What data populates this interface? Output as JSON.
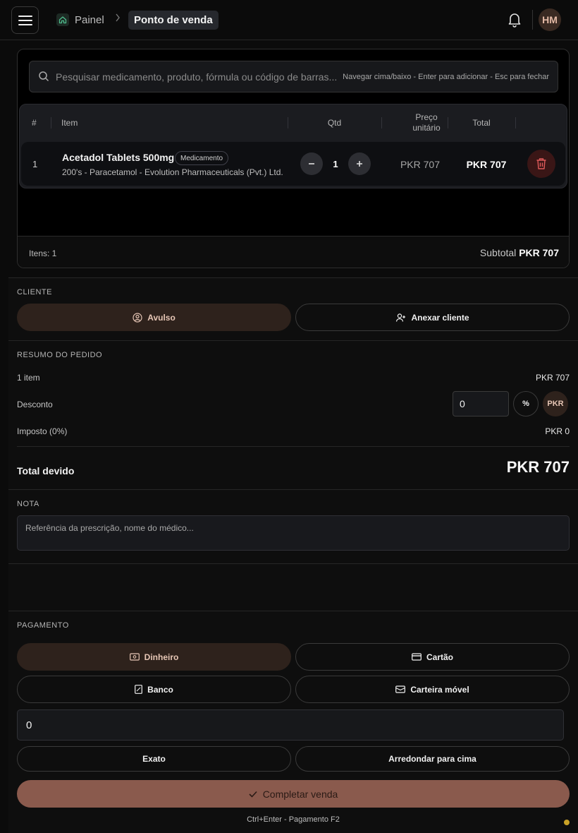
{
  "header": {
    "breadcrumb_home": "Painel",
    "breadcrumb_current": "Ponto de venda",
    "avatar_initials": "HM"
  },
  "search": {
    "placeholder": "Pesquisar medicamento, produto, fórmula ou código de barras...",
    "hint": "Navegar cima/baixo - Enter para adicionar - Esc para fechar"
  },
  "cart": {
    "columns": {
      "num": "#",
      "item": "Item",
      "qty": "Qtd",
      "unit_price": "Preço unitário",
      "total": "Total"
    },
    "items": [
      {
        "num": "1",
        "name": "Acetadol Tablets 500mg",
        "badge": "Medicamento",
        "description": "200's - Paracetamol - Evolution Pharmaceuticals (Pvt.) Ltd.",
        "qty": "1",
        "unit_price": "PKR 707",
        "total": "PKR 707"
      }
    ],
    "items_count": "Itens: 1",
    "subtotal_label": "Subtotal",
    "subtotal_value": "PKR 707"
  },
  "customer": {
    "label": "CLIENTE",
    "walk_in": "Avulso",
    "attach": "Anexar cliente"
  },
  "summary": {
    "label": "RESUMO DO PEDIDO",
    "items_label": "1 item",
    "items_value": "PKR 707",
    "discount_label": "Desconto",
    "discount_value": "0",
    "percent_option": "%",
    "currency_option": "PKR",
    "tax_label": "Imposto (0%)",
    "tax_value": "PKR 0",
    "total_label": "Total devido",
    "total_value": "PKR 707"
  },
  "note": {
    "label": "NOTA",
    "placeholder": "Referência da prescrição, nome do médico..."
  },
  "payment": {
    "label": "PAGAMENTO",
    "methods": [
      "Dinheiro",
      "Cartão",
      "Banco",
      "Carteira móvel"
    ],
    "selected_method": "Dinheiro",
    "amount": "0",
    "exact": "Exato",
    "round_up": "Arredondar para cima",
    "complete": "Completar venda",
    "shortcuts": "Ctrl+Enter - Pagamento F2"
  },
  "colors": {
    "accent": "#8a5a4d",
    "active_pill": "#2e221c",
    "delete": "#3a1616",
    "status_dot": "#c9a227"
  }
}
